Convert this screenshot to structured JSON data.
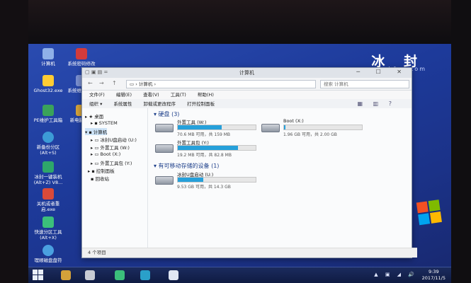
{
  "brand": {
    "title": "冰 封",
    "subtitle": "www.bfpe.com"
  },
  "desktop_icons": [
    {
      "label": "计算机",
      "color": "#8fb0e8"
    },
    {
      "label": "系统密码修改",
      "color": "#d23b3b"
    },
    {
      "label": "Ghost32.exe",
      "color": "#ffcc33"
    },
    {
      "label": "系统维护工具",
      "color": "#7a8fd0"
    },
    {
      "label": "PE维护工具箱",
      "color": "#3aa35a"
    },
    {
      "label": "新电脑系统",
      "color": "#d4a23a"
    },
    {
      "label": "新备份分区 (Alt+S)",
      "color": "#3c9bd6"
    },
    {
      "label": "冰封一键装机 (Alt+Z) V8...",
      "color": "#2ea66a"
    },
    {
      "label": "关机或者重启.exe",
      "color": "#d84a3a"
    },
    {
      "label": "快速分区工具 (Alt+X)",
      "color": "#3bbf7b"
    },
    {
      "label": "理顺磁盘盘符",
      "color": "#4aa0e0"
    }
  ],
  "window": {
    "title": "计算机",
    "title_left": "▢ ▣ ▤ =",
    "controls": "─ ☐ ✕",
    "nav_buttons": [
      "←",
      "→",
      "↑"
    ],
    "address": "▭ › 计算机 ›",
    "search_placeholder": "搜索 计算机",
    "menu": [
      "文件(F)",
      "编辑(E)",
      "查看(V)",
      "工具(T)",
      "帮助(H)"
    ],
    "commands": [
      "组织 ▾",
      "系统属性",
      "卸载或更改程序",
      "打开控制面板"
    ],
    "cmd_icons": "▦ ▥ ?",
    "nav_pane": [
      {
        "label": "▸ ★ 桌面",
        "indent": 0
      },
      {
        "label": "▸ ▪ SYSTEM",
        "indent": 1
      },
      {
        "label": "▾ ▪ 计算机",
        "indent": 0
      },
      {
        "label": "▸ ▭ 冰封U盘启动 (U:)",
        "indent": 2
      },
      {
        "label": "▸ ▭ 外置工具 (W:)",
        "indent": 2
      },
      {
        "label": "▸ ▭ Boot (X:)",
        "indent": 2
      },
      {
        "label": "▸ ▭ 外置工具包 (Y:)",
        "indent": 2
      },
      {
        "label": "▸ ▪ 控制面板",
        "indent": 1
      },
      {
        "label": "▪ 回收站",
        "indent": 1
      }
    ],
    "groups": {
      "hard_disks": "▾ 硬盘 (3)",
      "removable": "▾ 有可移动存储的设备 (1)"
    },
    "drives": [
      {
        "name": "外置工具 (W:)",
        "size": "70.6 MB 可用，共 159 MB",
        "used_fraction": 0.56
      },
      {
        "name": "Boot (X:)",
        "size": "1.96 GB 可用，共 2.00 GB",
        "used_fraction": 0.02
      },
      {
        "name": "外置工具包 (Y:)",
        "size": "19.2 MB 可用，共 82.8 MB",
        "used_fraction": 0.77
      },
      {
        "name": "冰封U盘启动 (U:)",
        "size": "9.53 GB 可用，共 14.3 GB",
        "used_fraction": 0.33
      }
    ],
    "status": "4 个项目"
  },
  "taskbar": {
    "tray_icons": "▲ ▣ ◢ 🔊",
    "time": "9:39",
    "date": "2017/11/5"
  }
}
